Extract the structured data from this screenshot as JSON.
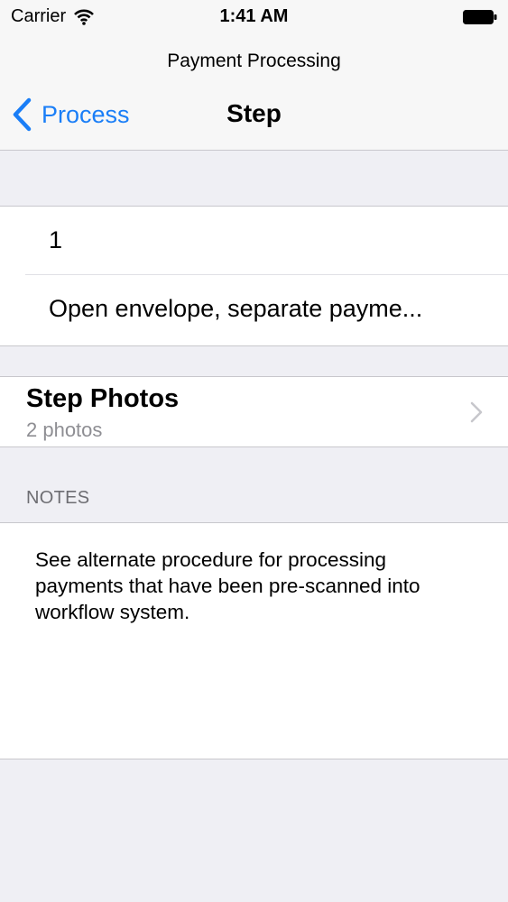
{
  "status_bar": {
    "carrier": "Carrier",
    "time": "1:41 AM"
  },
  "prompt": "Payment Processing",
  "nav": {
    "back_label": "Process",
    "title": "Step"
  },
  "step": {
    "number": "1",
    "description": "Open envelope, separate payme..."
  },
  "photos": {
    "title": "Step Photos",
    "subtitle": "2 photos"
  },
  "notes": {
    "header": "NOTES",
    "text": "See alternate procedure for processing payments that have been pre-scanned into workflow system."
  },
  "colors": {
    "accent": "#1a7ef7",
    "background": "#efeff4",
    "bar": "#f7f7f7"
  },
  "icons": [
    "wifi-icon",
    "battery-icon",
    "back-chevron-icon",
    "chevron-right-icon"
  ]
}
